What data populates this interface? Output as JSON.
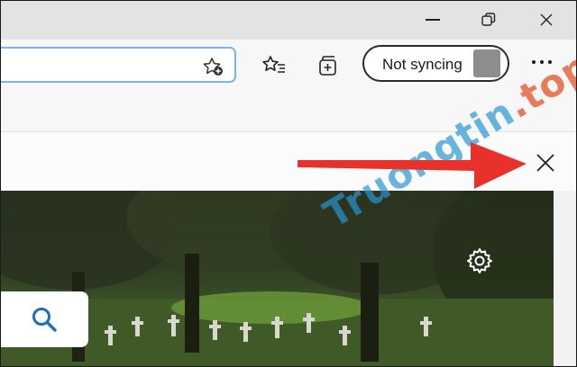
{
  "toolbar": {
    "sync_label": "Not syncing"
  },
  "watermark": {
    "main": "Truongtin",
    "suffix": ".top"
  },
  "icons": [
    "minimize-icon",
    "restore-icon",
    "close-icon",
    "favorite-add-icon",
    "favorites-list-icon",
    "collections-icon",
    "more-icon",
    "settings-gear-icon",
    "search-icon",
    "dismiss-icon"
  ],
  "annotation": {
    "arrow_color": "#e8312a"
  },
  "colors": {
    "address_focus": "#7fb2e5",
    "search_icon": "#1a6fc4"
  }
}
